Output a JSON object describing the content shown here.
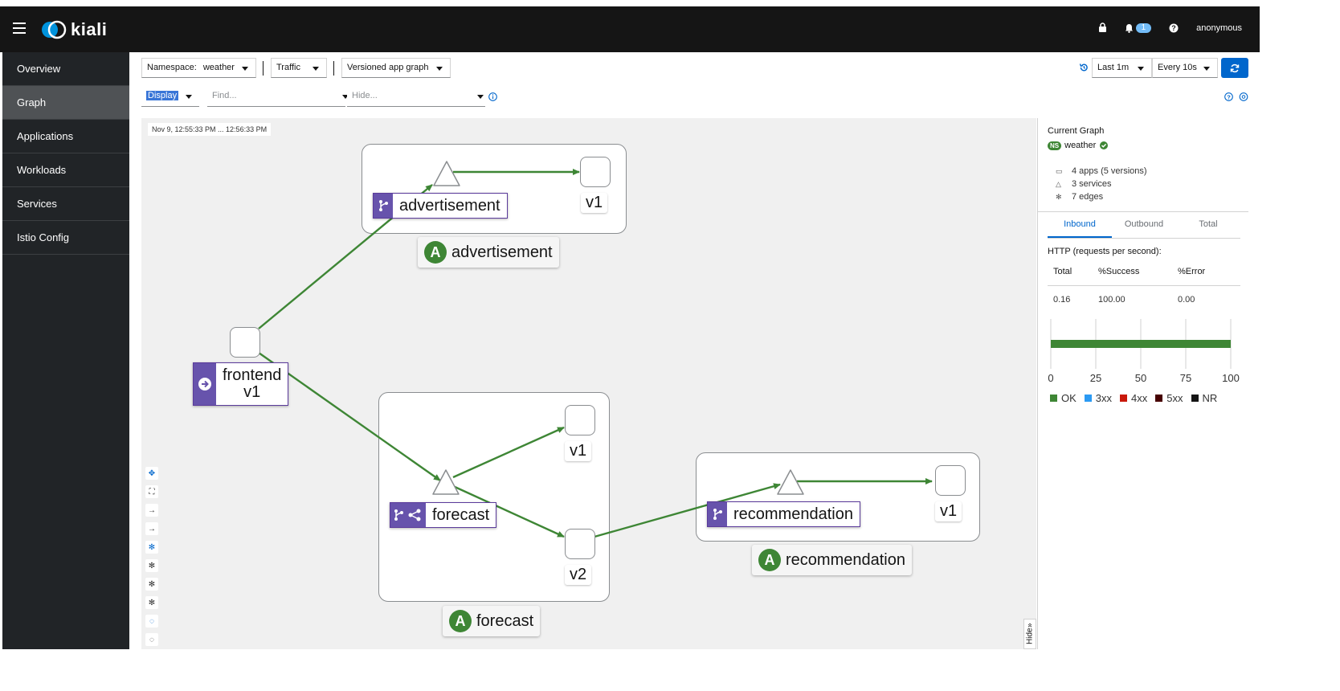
{
  "masthead": {
    "brand": "kiali",
    "notification_count": "1",
    "user": "anonymous"
  },
  "sidebar": {
    "items": [
      {
        "label": "Overview"
      },
      {
        "label": "Graph"
      },
      {
        "label": "Applications"
      },
      {
        "label": "Workloads"
      },
      {
        "label": "Services"
      },
      {
        "label": "Istio Config"
      }
    ]
  },
  "toolbar": {
    "namespace_label": "Namespace:",
    "namespace_value": "weather",
    "traffic_label": "Traffic",
    "graph_type": "Versioned app graph",
    "time_range": "Last 1m",
    "refresh_interval": "Every 10s",
    "display_label": "Display",
    "find_placeholder": "Find...",
    "hide_placeholder": "Hide..."
  },
  "graph": {
    "timestamp": "Nov 9, 12:55:33 PM ... 12:56:33 PM",
    "nodes": {
      "advertisement_service": "advertisement",
      "advertisement_v1": "v1",
      "advertisement_app": "advertisement",
      "frontend_line1": "frontend",
      "frontend_line2": "v1",
      "forecast_service": "forecast",
      "forecast_v1": "v1",
      "forecast_v2": "v2",
      "forecast_app": "forecast",
      "recommendation_service": "recommendation",
      "recommendation_v1": "v1",
      "recommendation_app": "recommendation"
    },
    "app_badge_letter": "A",
    "hide_label": "Hide"
  },
  "panel": {
    "title": "Current Graph",
    "ns_badge": "NS",
    "namespace": "weather",
    "apps": "4 apps (5 versions)",
    "services": "3 services",
    "edges": "7 edges",
    "tabs": [
      "Inbound",
      "Outbound",
      "Total"
    ],
    "http_title": "HTTP (requests per second):",
    "table_headers": [
      "Total",
      "%Success",
      "%Error"
    ],
    "table_values": [
      "0.16",
      "100.00",
      "0.00"
    ],
    "bar_ok_percent": 100,
    "axis_ticks": [
      "0",
      "25",
      "50",
      "75",
      "100"
    ],
    "legend": [
      {
        "label": "OK",
        "color": "#3e8635"
      },
      {
        "label": "3xx",
        "color": "#2b9af3"
      },
      {
        "label": "4xx",
        "color": "#c9190b"
      },
      {
        "label": "5xx",
        "color": "#470000"
      },
      {
        "label": "NR",
        "color": "#151515"
      }
    ]
  },
  "colors": {
    "edge": "#3e8635",
    "accent": "#0066cc",
    "purple": "#6753ac"
  }
}
